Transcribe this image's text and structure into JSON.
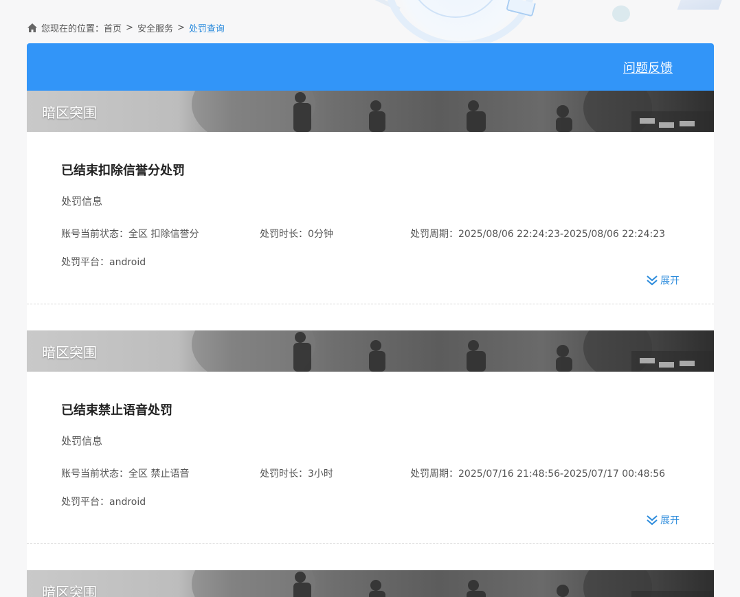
{
  "breadcrumb": {
    "prefix": "您现在的位置：",
    "items": [
      "首页",
      "安全服务"
    ],
    "current": "处罚查询",
    "separator": ">"
  },
  "header": {
    "feedback_label": "问题反馈"
  },
  "labels": {
    "section": "处罚信息",
    "status_prefix": "账号当前状态：",
    "duration_prefix": "处罚时长：",
    "period_prefix": "处罚周期：",
    "platform_prefix": "处罚平台：",
    "expand": "展开"
  },
  "records": [
    {
      "game": "暗区突围",
      "title": "已结束扣除信誉分处罚",
      "status": "全区 扣除信誉分",
      "duration": "0分钟",
      "period": "2025/08/06 22:24:23-2025/08/06 22:24:23",
      "platform": "android"
    },
    {
      "game": "暗区突围",
      "title": "已结束禁止语音处罚",
      "status": "全区 禁止语音",
      "duration": "3小时",
      "period": "2025/07/16 21:48:56-2025/07/17 00:48:56",
      "platform": "android"
    },
    {
      "game": "暗区突围"
    }
  ],
  "colors": {
    "header_blue": "#3295f8",
    "link_blue": "#2b8bdc"
  },
  "icons": {
    "home": "home-icon",
    "expand": "double-chevron-down-icon"
  }
}
